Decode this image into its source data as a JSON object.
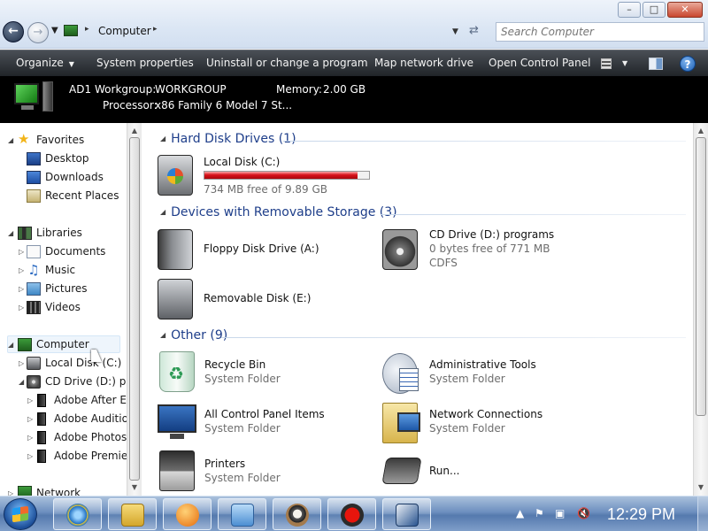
{
  "window": {
    "min": "–",
    "max": "□",
    "close": "✕"
  },
  "address": {
    "path": "Computer",
    "search_placeholder": "Search Computer"
  },
  "toolbar": {
    "organize": "Organize",
    "system_properties": "System properties",
    "uninstall": "Uninstall or change a program",
    "map_drive": "Map network drive",
    "control_panel": "Open Control Panel",
    "help": "?"
  },
  "info": {
    "name": "AD1",
    "workgroup_label": "Workgroup:",
    "workgroup": "WORKGROUP",
    "memory_label": "Memory:",
    "memory": "2.00 GB",
    "processor_label": "Processor:",
    "processor": "x86 Family 6 Model 7 St..."
  },
  "nav": {
    "favorites": "Favorites",
    "desktop": "Desktop",
    "downloads": "Downloads",
    "recent": "Recent Places",
    "libraries": "Libraries",
    "documents": "Documents",
    "music": "Music",
    "pictures": "Pictures",
    "videos": "Videos",
    "computer": "Computer",
    "local_disk": "Local Disk (C:)",
    "cd_drive": "CD Drive (D:) pro",
    "adobe_ae": "Adobe After Eff",
    "adobe_au": "Adobe Audition",
    "adobe_ps": "Adobe Photosh",
    "adobe_pr": "Adobe Premier",
    "network": "Network"
  },
  "groups": {
    "hdd": "Hard Disk Drives (1)",
    "removable": "Devices with Removable Storage (3)",
    "other": "Other (9)"
  },
  "items": {
    "local_disk": {
      "name": "Local Disk (C:)",
      "free": "734 MB free of 9.89 GB",
      "used_fraction": 0.93
    },
    "floppy": {
      "name": "Floppy Disk Drive (A:)"
    },
    "cd": {
      "name": "CD Drive (D:) programs",
      "free": "0 bytes free of 771 MB",
      "fs": "CDFS"
    },
    "removable": {
      "name": "Removable Disk (E:)"
    },
    "recycle": {
      "name": "Recycle Bin",
      "type": "System Folder"
    },
    "admin": {
      "name": "Administrative Tools",
      "type": "System Folder"
    },
    "cpl": {
      "name": "All Control Panel Items",
      "type": "System Folder"
    },
    "netconn": {
      "name": "Network Connections",
      "type": "System Folder"
    },
    "printers": {
      "name": "Printers",
      "type": "System Folder"
    },
    "run": {
      "name": "Run..."
    }
  },
  "taskbar": {
    "clock": "12:29 PM"
  },
  "colors": {
    "disk_bar": "#d9141b",
    "group_header": "#1e3e8a",
    "toolbar_bg": "#202428"
  }
}
